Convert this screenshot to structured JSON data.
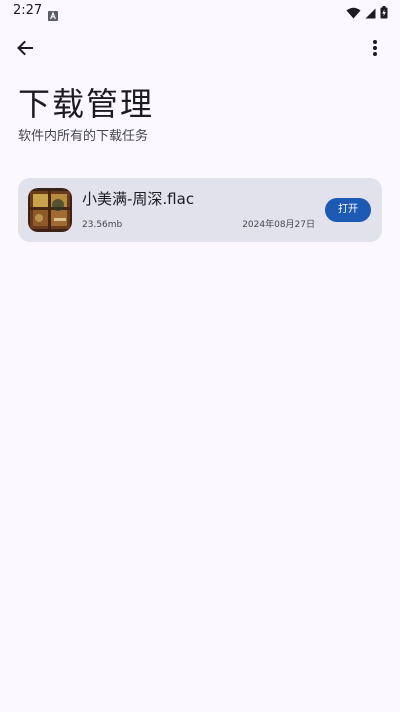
{
  "status_bar": {
    "time": "2:27",
    "icons": [
      "notification-a-icon",
      "wifi-icon",
      "signal-icon",
      "battery-charging-icon"
    ]
  },
  "toolbar": {
    "back_icon": "arrow-back-icon",
    "more_icon": "more-vert-icon"
  },
  "page": {
    "title": "下载管理",
    "subtitle": "软件内所有的下载任务"
  },
  "downloads": [
    {
      "file_name": "小美满-周深.flac",
      "size": "23.56mb",
      "date": "2024年08月27日",
      "action_label": "打开"
    }
  ],
  "colors": {
    "background": "#fcf8ff",
    "card": "#e1e2ec",
    "primary": "#1c5ab4",
    "text": "#1b1b21"
  }
}
